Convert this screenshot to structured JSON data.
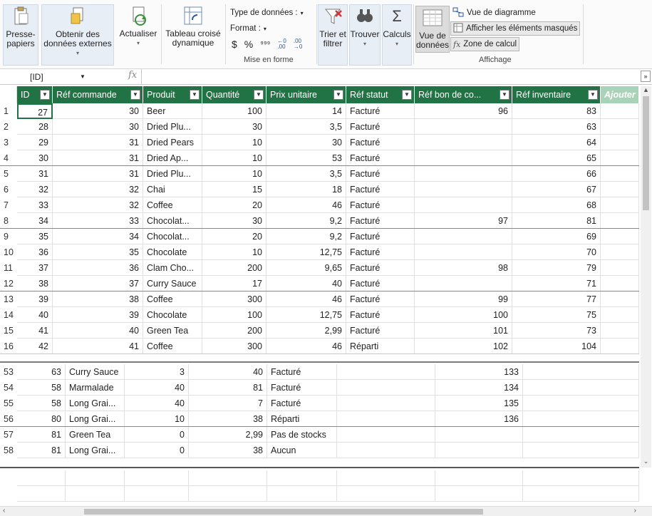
{
  "ribbon": {
    "clipboard": "Presse-\npapiers",
    "get_external_l1": "Obtenir des",
    "get_external_l2": "données externes",
    "refresh": "Actualiser",
    "pivot_l1": "Tableau croisé",
    "pivot_l2": "dynamique",
    "data_type": "Type de données :",
    "format": "Format :",
    "currency": "$",
    "percent": "%",
    "comma": "⁹⁹⁹",
    "dec_inc": "←0\n.00",
    "dec_dec": ".00\n→0",
    "format_group": "Mise en forme",
    "sort_l1": "Trier et",
    "sort_l2": "filtrer",
    "find": "Trouver",
    "calc": "Calculs",
    "view_data_l1": "Vue de",
    "view_data_l2": "données",
    "diagram_view": "Vue de diagramme",
    "show_hidden": "Afficher les éléments masqués",
    "calc_area": "Zone de calcul",
    "view_group": "Affichage"
  },
  "formula": {
    "name_box": "[ID]",
    "fx": "fx",
    "value": ""
  },
  "columns": [
    "ID",
    "Réf commande",
    "Produit",
    "Quantité",
    "Prix unitaire",
    "Réf statut",
    "Réf bon de co...",
    "Réf inventaire",
    "Ajouter"
  ],
  "rows_top": [
    [
      "1",
      "27",
      "30",
      "Beer",
      "100",
      "14",
      "Facturé",
      "96",
      "83"
    ],
    [
      "2",
      "28",
      "30",
      "Dried Plu...",
      "30",
      "3,5",
      "Facturé",
      "",
      "63"
    ],
    [
      "3",
      "29",
      "31",
      "Dried Pears",
      "10",
      "30",
      "Facturé",
      "",
      "64"
    ],
    [
      "4",
      "30",
      "31",
      "Dried Ap...",
      "10",
      "53",
      "Facturé",
      "",
      "65"
    ],
    [
      "5",
      "31",
      "31",
      "Dried Plu...",
      "10",
      "3,5",
      "Facturé",
      "",
      "66"
    ],
    [
      "6",
      "32",
      "32",
      "Chai",
      "15",
      "18",
      "Facturé",
      "",
      "67"
    ],
    [
      "7",
      "33",
      "32",
      "Coffee",
      "20",
      "46",
      "Facturé",
      "",
      "68"
    ],
    [
      "8",
      "34",
      "33",
      "Chocolat...",
      "30",
      "9,2",
      "Facturé",
      "97",
      "81"
    ],
    [
      "9",
      "35",
      "34",
      "Chocolat...",
      "20",
      "9,2",
      "Facturé",
      "",
      "69"
    ],
    [
      "10",
      "36",
      "35",
      "Chocolate",
      "10",
      "12,75",
      "Facturé",
      "",
      "70"
    ],
    [
      "11",
      "37",
      "36",
      "Clam Cho...",
      "200",
      "9,65",
      "Facturé",
      "98",
      "79"
    ],
    [
      "12",
      "38",
      "37",
      "Curry Sauce",
      "17",
      "40",
      "Facturé",
      "",
      "71"
    ],
    [
      "13",
      "39",
      "38",
      "Coffee",
      "300",
      "46",
      "Facturé",
      "99",
      "77"
    ],
    [
      "14",
      "40",
      "39",
      "Chocolate",
      "100",
      "12,75",
      "Facturé",
      "100",
      "75"
    ],
    [
      "15",
      "41",
      "40",
      "Green Tea",
      "200",
      "2,99",
      "Facturé",
      "101",
      "73"
    ],
    [
      "16",
      "42",
      "41",
      "Coffee",
      "300",
      "46",
      "Réparti",
      "102",
      "104"
    ]
  ],
  "rows_bottom": [
    [
      "53",
      "63",
      "Curry Sauce",
      "3",
      "40",
      "Facturé",
      "",
      "133"
    ],
    [
      "54",
      "58",
      "Marmalade",
      "40",
      "81",
      "Facturé",
      "",
      "134"
    ],
    [
      "55",
      "58",
      "Long Grai...",
      "40",
      "7",
      "Facturé",
      "",
      "135"
    ],
    [
      "56",
      "80",
      "Long Grai...",
      "10",
      "38",
      "Réparti",
      "",
      "136"
    ],
    [
      "57",
      "81",
      "Green Tea",
      "0",
      "2,99",
      "Pas de stocks",
      "",
      ""
    ],
    [
      "58",
      "81",
      "Long Grai...",
      "0",
      "38",
      "Aucun",
      "",
      ""
    ]
  ],
  "colors": {
    "header_green": "#217346",
    "add_col": "#a9d3b8",
    "accent_blue": "#2b579a"
  },
  "icons": [
    "clipboard-icon",
    "external-data-icon",
    "refresh-icon",
    "pivot-table-icon",
    "sort-filter-icon",
    "find-icon",
    "calculations-icon",
    "data-view-icon",
    "diagram-view-icon",
    "show-hidden-icon",
    "calc-area-icon"
  ]
}
